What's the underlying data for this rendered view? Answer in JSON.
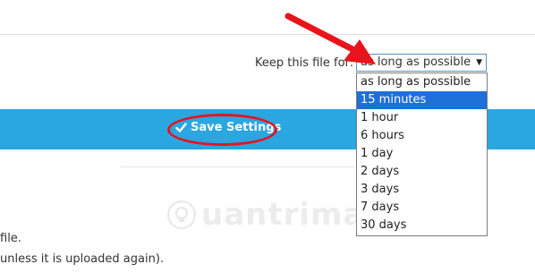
{
  "settings": {
    "keep_label": "Keep this file for:",
    "selected_value": "as long as possible",
    "options": [
      "as long as possible",
      "15 minutes",
      "1 hour",
      "6 hours",
      "1 day",
      "2 days",
      "3 days",
      "7 days",
      "30 days"
    ],
    "highlighted_option": "15 minutes",
    "save_label": "Save Settings"
  },
  "body": {
    "line1": "file.",
    "line2": "unless it is uploaded again)."
  },
  "watermark": {
    "text": "uantrimang"
  },
  "colors": {
    "bar": "#2aa6e0",
    "highlight": "#1f6fd8",
    "annotation": "#e8141c"
  },
  "icons": {
    "save": "check-icon",
    "caret": "caret-down-icon",
    "annotation_arrow": "red-arrow-icon",
    "watermark_logo": "lightbulb-icon"
  }
}
